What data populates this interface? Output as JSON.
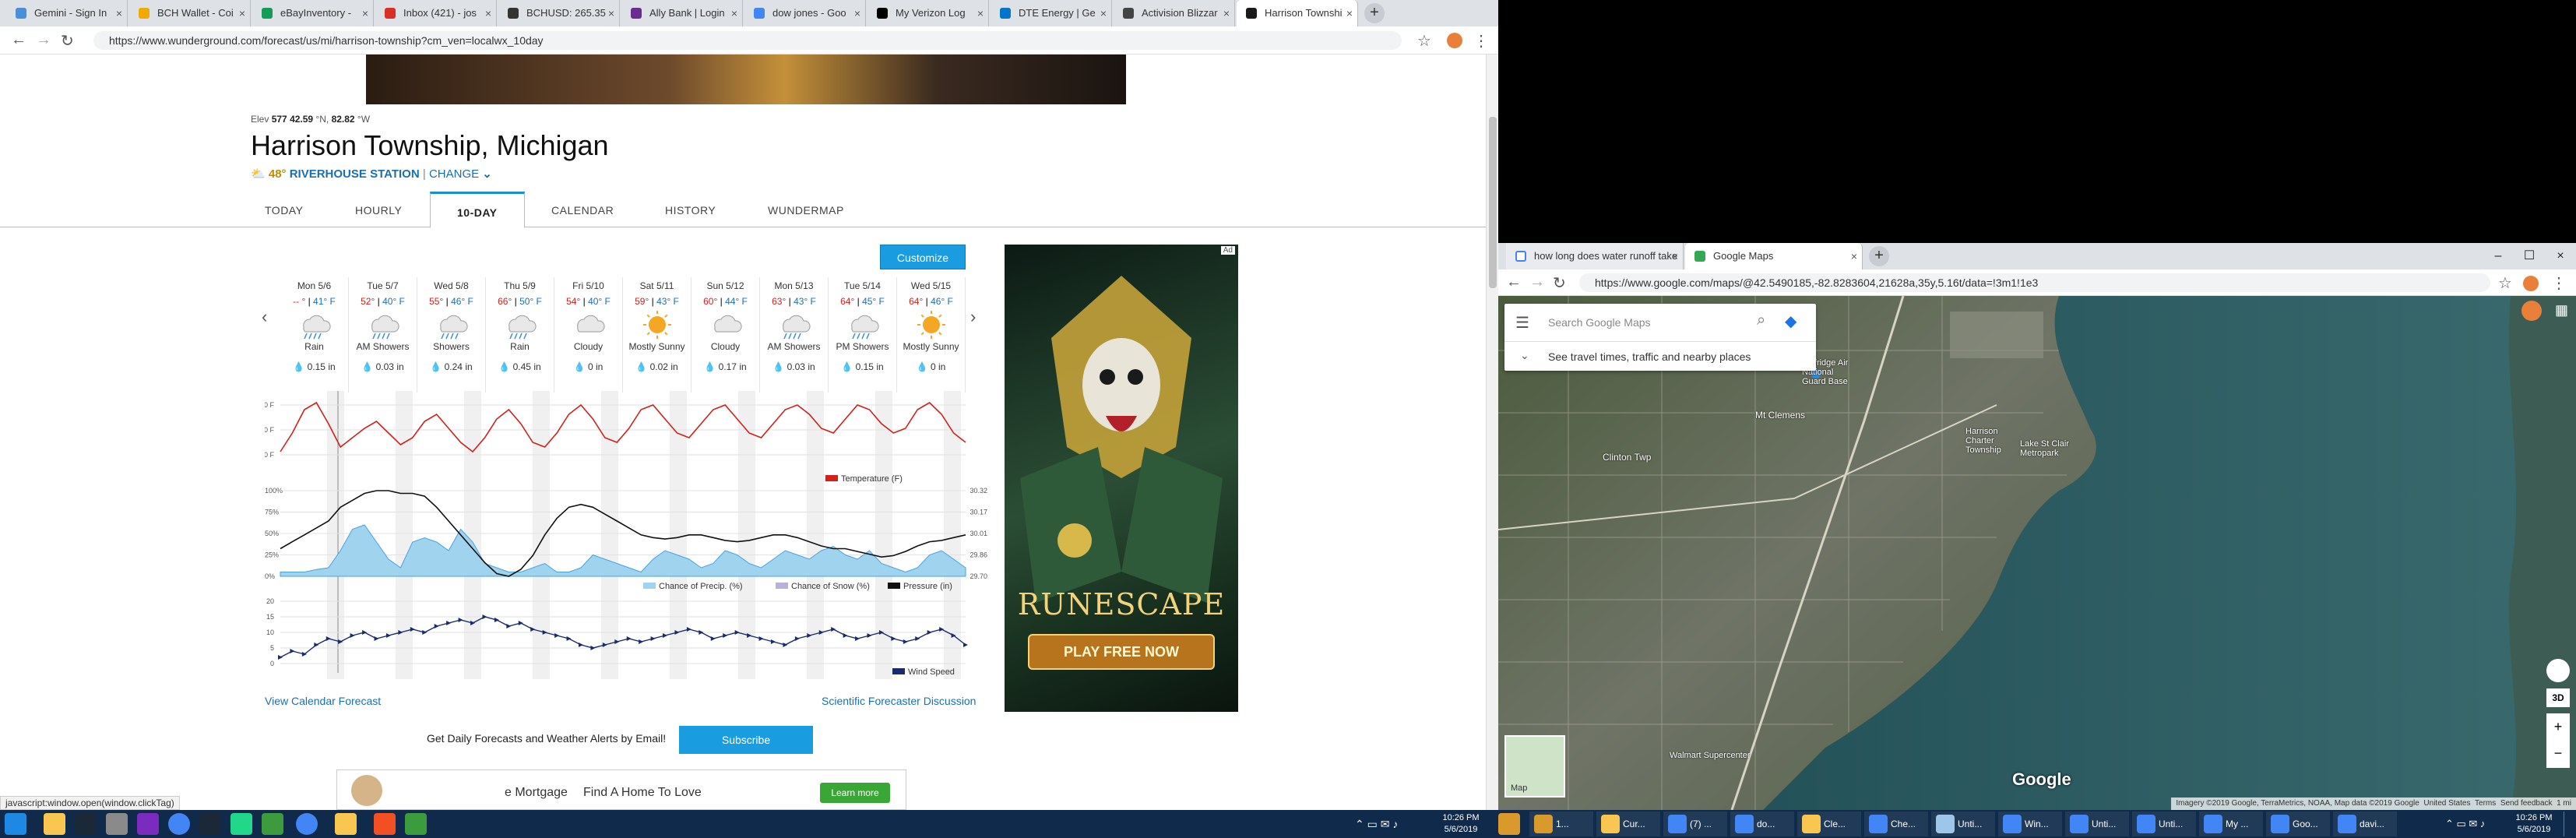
{
  "left_browser": {
    "tabs": [
      {
        "label": "Gemini - Sign In",
        "color": "#4a90d9"
      },
      {
        "label": "BCH Wallet - Coi",
        "color": "#f2a900"
      },
      {
        "label": "eBayInventory - ",
        "color": "#0f9d58"
      },
      {
        "label": "Inbox (421) - jos",
        "color": "#d93025"
      },
      {
        "label": "BCHUSD: 265.35",
        "color": "#333333"
      },
      {
        "label": "Ally Bank | Login",
        "color": "#6a2c91"
      },
      {
        "label": "dow jones - Goo",
        "color": "#4285f4"
      },
      {
        "label": "My Verizon Log",
        "color": "#000000"
      },
      {
        "label": "DTE Energy | Ge",
        "color": "#0077c8"
      },
      {
        "label": "Activision Blizzar",
        "color": "#444444"
      },
      {
        "label": "Harrison Townshi",
        "color": "#1a1a1a"
      }
    ],
    "url": "https://www.wunderground.com/forecast/us/mi/harrison-township?cm_ven=localwx_10day",
    "status_url": "javascript:window.open(window.clickTag)"
  },
  "weather": {
    "elevation_line": {
      "prefix": "Elev ",
      "elev": "577",
      "lat": "42.59",
      "lat_unit": " °N, ",
      "lon": "82.82",
      "lon_unit": " °W"
    },
    "city": "Harrison Township, Michigan",
    "station_temp": "48°",
    "station_name": "RIVERHOUSE STATION",
    "separator": "|",
    "change_label": "CHANGE",
    "tabs": [
      "TODAY",
      "HOURLY",
      "10-DAY",
      "CALENDAR",
      "HISTORY",
      "WUNDERMAP"
    ],
    "active_tab": "10-DAY",
    "customize_label": "Customize",
    "days": [
      {
        "name": "Mon 5/6",
        "hi": "-- °",
        "lo": "41° F",
        "cond": "Rain",
        "precip": "0.15 in",
        "icon": "rain-icon"
      },
      {
        "name": "Tue 5/7",
        "hi": "52°",
        "lo": "40° F",
        "cond": "AM Showers",
        "precip": "0.03 in",
        "icon": "showers-icon"
      },
      {
        "name": "Wed 5/8",
        "hi": "55°",
        "lo": "46° F",
        "cond": "Showers",
        "precip": "0.24 in",
        "icon": "showers-icon"
      },
      {
        "name": "Thu 5/9",
        "hi": "66°",
        "lo": "50° F",
        "cond": "Rain",
        "precip": "0.45 in",
        "icon": "rain-icon"
      },
      {
        "name": "Fri 5/10",
        "hi": "54°",
        "lo": "40° F",
        "cond": "Cloudy",
        "precip": "0 in",
        "icon": "cloud-icon"
      },
      {
        "name": "Sat 5/11",
        "hi": "59°",
        "lo": "43° F",
        "cond": "Mostly Sunny",
        "precip": "0.02 in",
        "icon": "sun-icon"
      },
      {
        "name": "Sun 5/12",
        "hi": "60°",
        "lo": "44° F",
        "cond": "Cloudy",
        "precip": "0.17 in",
        "icon": "cloud-icon"
      },
      {
        "name": "Mon 5/13",
        "hi": "63°",
        "lo": "43° F",
        "cond": "AM Showers",
        "precip": "0.03 in",
        "icon": "showers-icon"
      },
      {
        "name": "Tue 5/14",
        "hi": "64°",
        "lo": "45° F",
        "cond": "PM Showers",
        "precip": "0.15 in",
        "icon": "showers-icon"
      },
      {
        "name": "Wed 5/15",
        "hi": "64°",
        "lo": "46° F",
        "cond": "Mostly Sunny",
        "precip": "0 in",
        "icon": "sun-icon"
      }
    ],
    "legend": {
      "temperature": "Temperature (F)",
      "precip": "Chance of Precip. (%)",
      "snow": "Chance of Snow (%)",
      "pressure": "Pressure (in)",
      "wind": "Wind Speed"
    },
    "links": {
      "calendar": "View Calendar Forecast",
      "scientific": "Scientific Forecaster Discussion"
    },
    "alerts_text": "Get Daily Forecasts and Weather Alerts by Email!",
    "subscribe_label": "Subscribe",
    "bottom_ad": {
      "mortgage": "e Mortgage",
      "find": "Find A Home To Love",
      "learn": "Learn more"
    },
    "side_ad": {
      "brand": "RUNESCAPE",
      "cta": "PLAY FREE NOW",
      "ad_label": "Ad"
    }
  },
  "chart_data": [
    {
      "type": "line",
      "title": "",
      "series": [
        {
          "name": "Temperature (F)",
          "values": [
            42,
            50,
            60,
            63,
            54,
            44,
            48,
            52,
            55,
            50,
            45,
            48,
            55,
            58,
            52,
            46,
            42,
            48,
            56,
            60,
            54,
            46,
            44,
            50,
            58,
            62,
            56,
            48,
            46,
            52,
            60,
            62,
            56,
            50,
            48,
            54,
            60,
            62,
            56,
            50,
            48,
            54,
            60,
            62,
            58,
            52,
            50,
            56,
            62,
            60,
            54,
            50,
            52,
            60,
            63,
            58,
            50,
            46
          ]
        }
      ],
      "yticks": [
        "60 F",
        "50 F",
        "40 F"
      ],
      "ylim": [
        38,
        68
      ]
    },
    {
      "type": "area",
      "series": [
        {
          "name": "Chance of Precip. (%)",
          "values": [
            5,
            5,
            5,
            8,
            10,
            30,
            55,
            60,
            40,
            20,
            10,
            40,
            45,
            40,
            30,
            55,
            40,
            15,
            10,
            5,
            5,
            10,
            15,
            5,
            5,
            10,
            25,
            20,
            15,
            10,
            5,
            20,
            30,
            25,
            20,
            10,
            15,
            30,
            25,
            15,
            10,
            20,
            30,
            25,
            20,
            30,
            35,
            25,
            20,
            30,
            15,
            10,
            5,
            10,
            25,
            30,
            20,
            10
          ]
        },
        {
          "name": "Pressure (in)",
          "values": [
            29.9,
            29.95,
            30.0,
            30.05,
            30.1,
            30.2,
            30.25,
            30.3,
            30.32,
            30.32,
            30.3,
            30.3,
            30.28,
            30.2,
            30.1,
            30.0,
            29.9,
            29.8,
            29.72,
            29.7,
            29.75,
            29.85,
            30.0,
            30.12,
            30.2,
            30.22,
            30.2,
            30.15,
            30.1,
            30.05,
            30.0,
            29.98,
            29.97,
            29.98,
            30.0,
            30.0,
            29.98,
            29.96,
            29.95,
            29.96,
            29.98,
            30.0,
            30.0,
            29.98,
            29.95,
            29.92,
            29.9,
            29.9,
            29.88,
            29.86,
            29.84,
            29.85,
            29.88,
            29.92,
            29.95,
            29.96,
            29.98,
            30.0
          ]
        }
      ],
      "yticks_left": [
        "100%",
        "75%",
        "50%",
        "25%",
        "0%"
      ],
      "yticks_right": [
        "30.32",
        "30.17",
        "30.01",
        "29.86",
        "29.70"
      ]
    },
    {
      "type": "line",
      "series": [
        {
          "name": "Wind Speed",
          "values": [
            2,
            4,
            3,
            6,
            8,
            7,
            9,
            10,
            8,
            9,
            10,
            11,
            10,
            12,
            13,
            14,
            13,
            15,
            14,
            12,
            13,
            11,
            10,
            9,
            8,
            6,
            5,
            6,
            7,
            8,
            7,
            8,
            9,
            10,
            11,
            10,
            8,
            9,
            10,
            9,
            8,
            7,
            6,
            8,
            9,
            10,
            11,
            9,
            8,
            9,
            10,
            8,
            7,
            8,
            10,
            11,
            9,
            6
          ]
        }
      ],
      "yticks": [
        "20",
        "15",
        "10",
        "5",
        "0"
      ],
      "ylim": [
        0,
        20
      ]
    }
  ],
  "right_browser": {
    "tabs": [
      {
        "label": "how long does water runoff take",
        "color": "#4285f4"
      },
      {
        "label": "Google Maps",
        "color": "#34a853"
      }
    ],
    "url": "https://www.google.com/maps/@42.5490185,-82.8283604,21628a,35y,5.16t/data=!3m1!1e3",
    "search_placeholder": "Search Google Maps",
    "travel_text": "See travel times, traffic and nearby places",
    "map_labels": {
      "airport": "Selfridge Air National Guard Base",
      "clinton": "Clinton Twp",
      "mount_clemens": "Mt Clemens",
      "harrison": "Harrison Charter Township",
      "metropark": "Lake St Clair Metropark",
      "walmart": "Walmart Supercenter"
    },
    "google_logo": "Google",
    "layer_label": "Map",
    "view_3d": "3D",
    "attribution": [
      "Imagery ©2019 Google, TerraMetrics, NOAA, Map data ©2019 Google",
      "United States",
      "Terms",
      "Send feedback",
      "1 mi"
    ]
  },
  "taskbar": {
    "clock_time": "10:26 PM",
    "clock_date": "5/6/2019",
    "right_items": [
      "1...",
      "Cur...",
      "(7) ...",
      "do...",
      "Cle...",
      "Che...",
      "Unti...",
      "Win...",
      "Unti...",
      "Unti...",
      "My ...",
      "Goo...",
      "davi..."
    ]
  }
}
